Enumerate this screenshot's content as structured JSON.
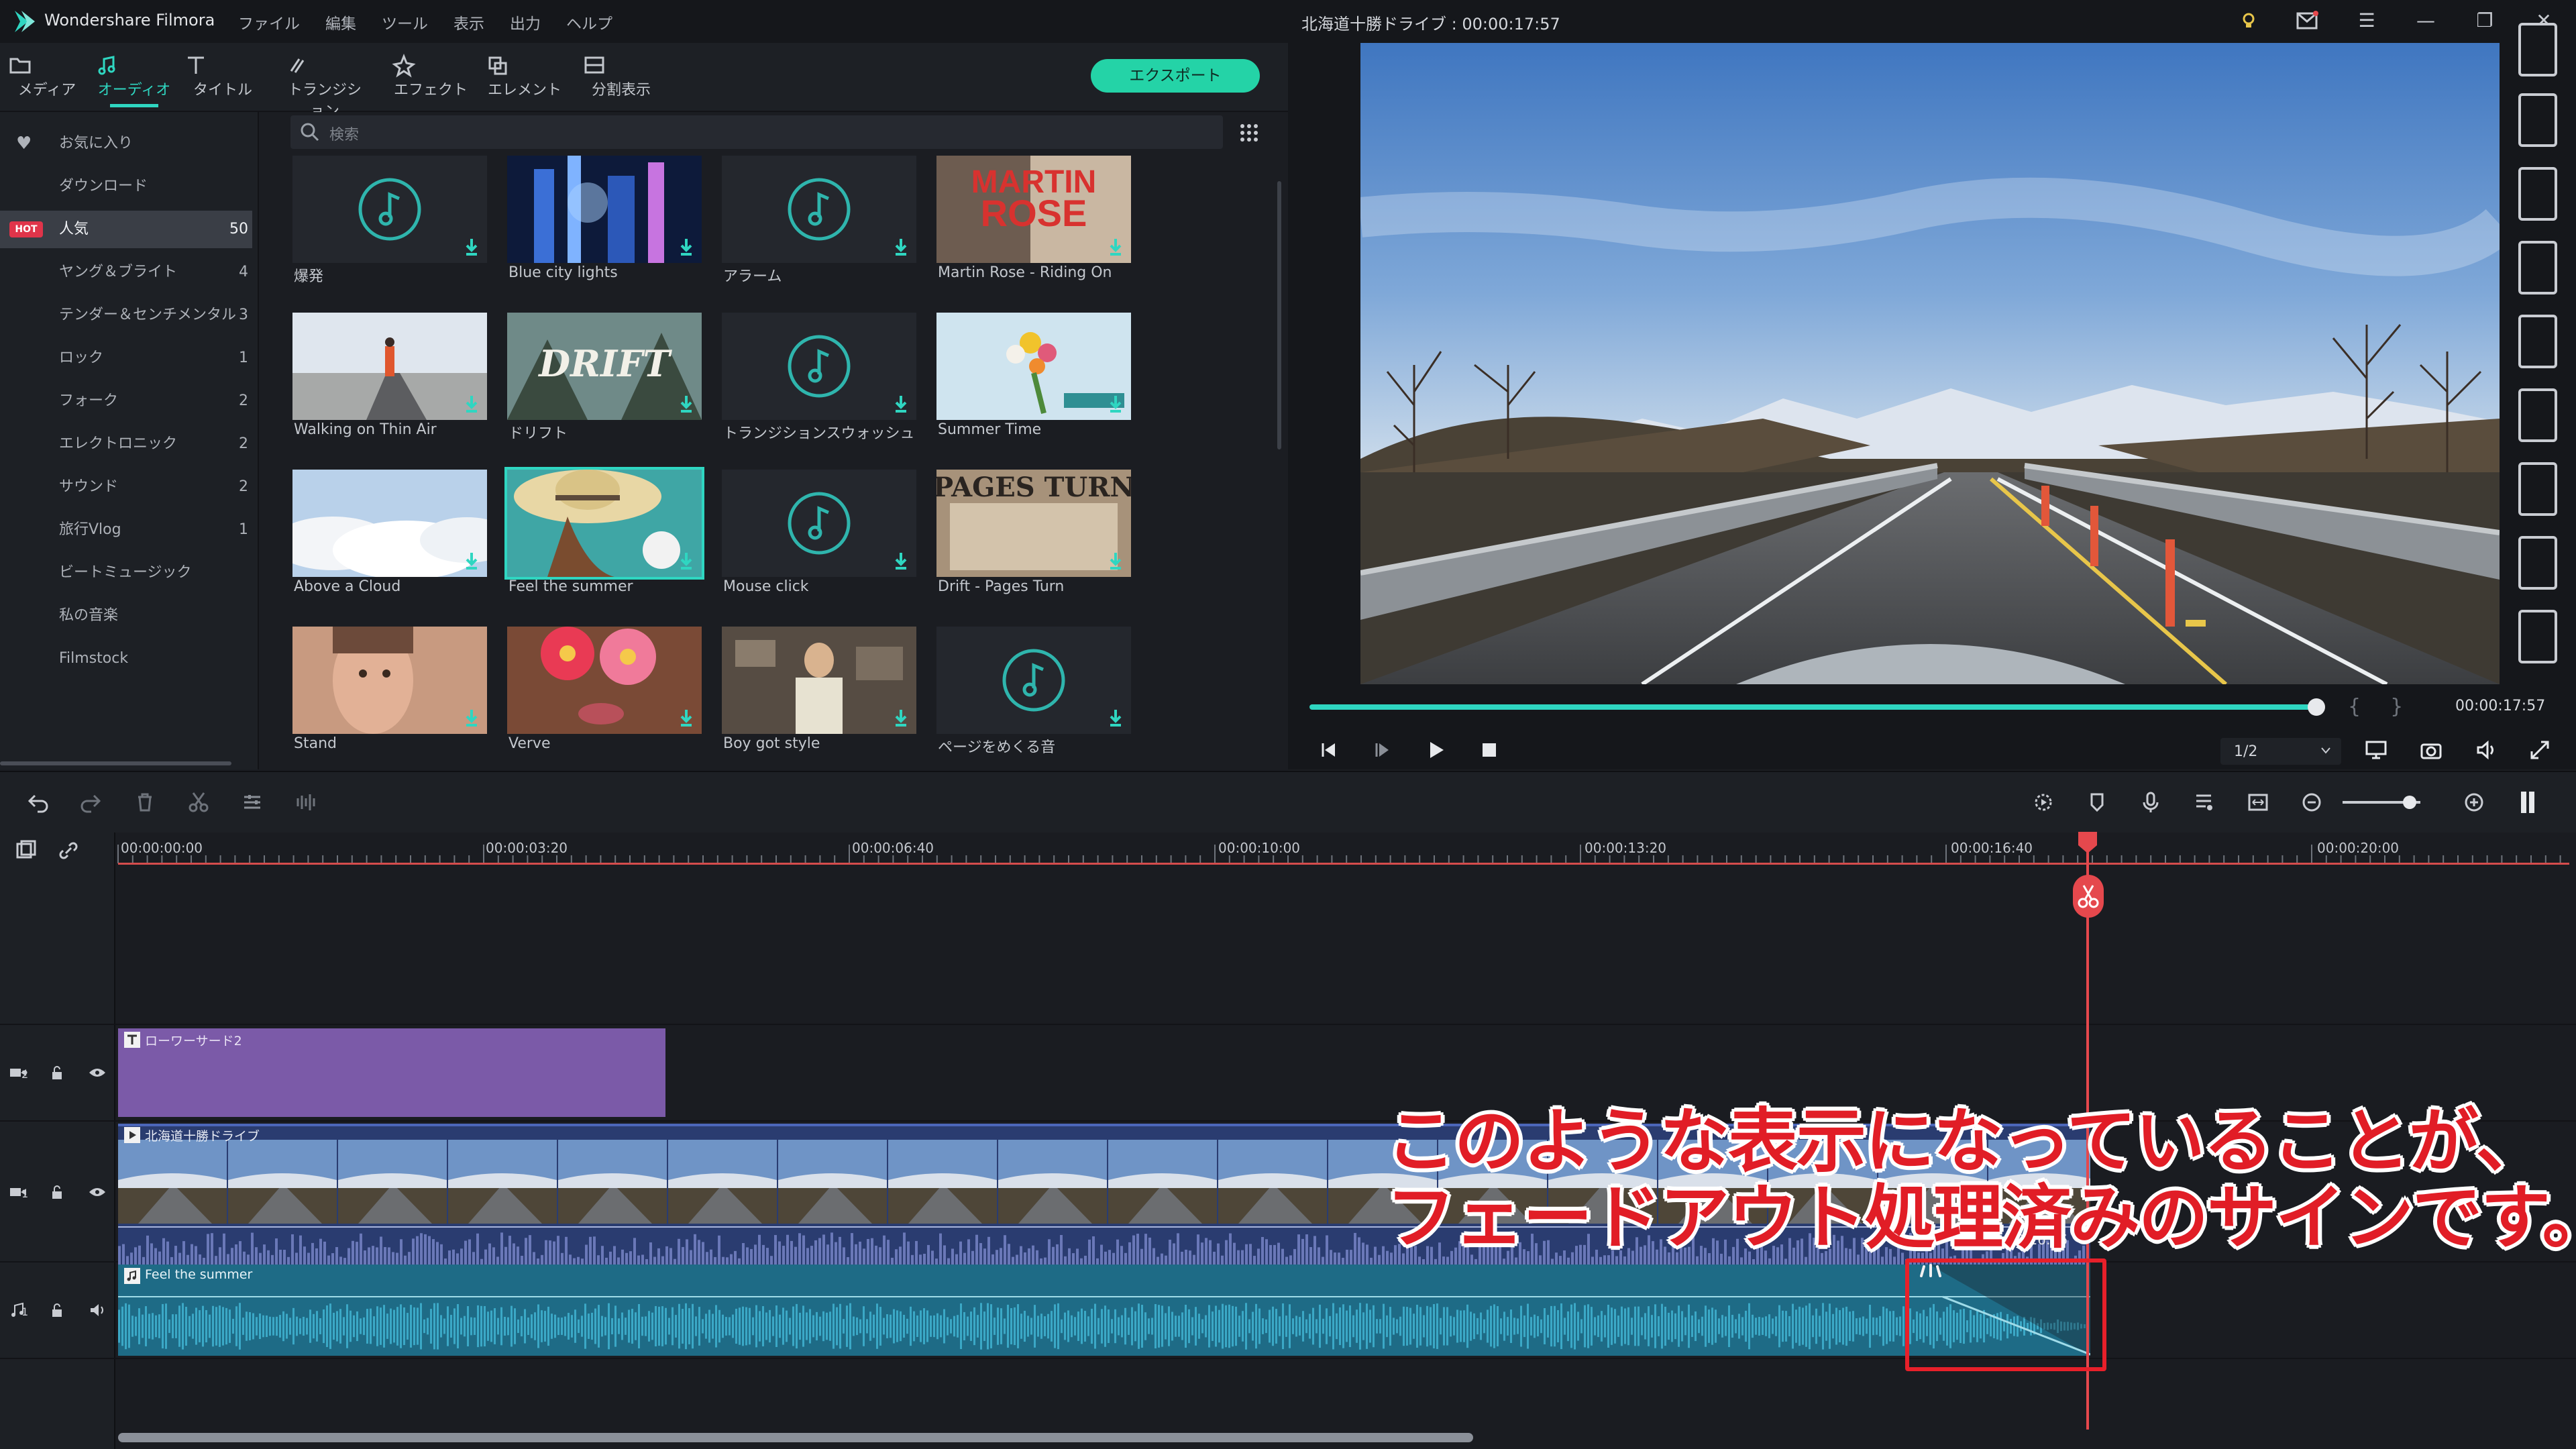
{
  "app": {
    "name": "Wondershare Filmora",
    "menu": [
      "ファイル",
      "編集",
      "ツール",
      "表示",
      "出力",
      "ヘルプ"
    ],
    "project_title": "北海道十勝ドライブ : 00:00:17:57"
  },
  "toolbar": {
    "tabs": [
      {
        "label": "メディア",
        "icon": "folder-icon"
      },
      {
        "label": "オーディオ",
        "icon": "music-note-icon",
        "active": true
      },
      {
        "label": "タイトル",
        "icon": "title-t-icon"
      },
      {
        "label": "トランジション",
        "icon": "transition-icon"
      },
      {
        "label": "エフェクト",
        "icon": "effect-icon"
      },
      {
        "label": "エレメント",
        "icon": "element-icon"
      },
      {
        "label": "分割表示",
        "icon": "split-screen-icon"
      }
    ],
    "export_label": "エクスポート"
  },
  "sidebar": {
    "items": [
      {
        "label": "お気に入り",
        "count": ""
      },
      {
        "label": "ダウンロード",
        "count": ""
      },
      {
        "label": "人気",
        "count": "50",
        "badge": "HOT",
        "active": true
      },
      {
        "label": "ヤング＆ブライト",
        "count": "4"
      },
      {
        "label": "テンダー＆センチメンタル",
        "count": "3"
      },
      {
        "label": "ロック",
        "count": "1"
      },
      {
        "label": "フォーク",
        "count": "2"
      },
      {
        "label": "エレクトロニック",
        "count": "2"
      },
      {
        "label": "サウンド",
        "count": "2"
      },
      {
        "label": "旅行Vlog",
        "count": "1"
      },
      {
        "label": "ビートミュージック",
        "count": ""
      },
      {
        "label": "私の音楽",
        "count": ""
      },
      {
        "label": "Filmstock",
        "count": ""
      }
    ]
  },
  "search": {
    "placeholder": "検索"
  },
  "library": {
    "items": [
      {
        "name": "爆発",
        "kind": "note"
      },
      {
        "name": "Blue city lights",
        "kind": "city"
      },
      {
        "name": "アラーム",
        "kind": "note"
      },
      {
        "name": "Martin Rose - Riding On",
        "kind": "martin",
        "thumb_text": "MARTIN ROSE"
      },
      {
        "name": "Walking on Thin Air",
        "kind": "walk"
      },
      {
        "name": "ドリフト",
        "kind": "drift",
        "thumb_text": "DRIFT"
      },
      {
        "name": "トランジションスウォッシュ",
        "kind": "note"
      },
      {
        "name": "Summer Time",
        "kind": "flowers"
      },
      {
        "name": "Above a Cloud",
        "kind": "cloud"
      },
      {
        "name": "Feel the summer",
        "kind": "hat",
        "selected": true
      },
      {
        "name": "Mouse click",
        "kind": "note"
      },
      {
        "name": "Drift - Pages Turn",
        "kind": "pages",
        "thumb_text": "PAGES TURN"
      },
      {
        "name": "Stand",
        "kind": "stand"
      },
      {
        "name": "Verve",
        "kind": "verve"
      },
      {
        "name": "Boy got style",
        "kind": "boy"
      },
      {
        "name": "ページをめくる音",
        "kind": "note"
      }
    ]
  },
  "preview": {
    "timecode": "00:00:17:57",
    "progress": 0.97,
    "ratio": "1/2"
  },
  "timeline": {
    "ruler": [
      "00:00:00:00",
      "00:00:03:20",
      "00:00:06:40",
      "00:00:10:00",
      "00:00:13:20",
      "00:00:16:40",
      "00:00:20:00"
    ],
    "tracks": {
      "title_clip": "ローワーサード2",
      "video_clip": "北海道十勝ドライブ",
      "audio_clip": "Feel the summer"
    },
    "track_labels": {
      "title": "2",
      "video": "1",
      "audio": "1"
    },
    "fade_time": "00:00:16:56"
  },
  "annotation": {
    "line1": "このような表示になっていることが、",
    "line2": "フェードアウト処理済みのサインです。",
    "color": "#e11d26"
  },
  "colors": {
    "accent": "#2fd6c1",
    "export": "#24d3a7",
    "playhead": "#e5484d",
    "title_clip": "#7b5aa8",
    "audio_clip": "#1e6b86"
  }
}
